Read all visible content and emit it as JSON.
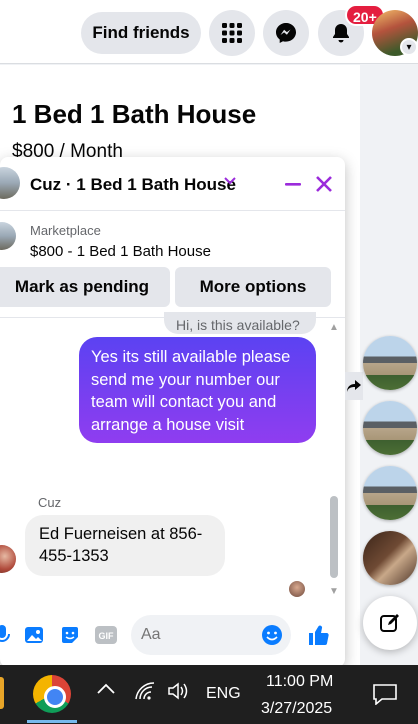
{
  "topbar": {
    "find_friends": "Find friends",
    "notification_badge": "20+",
    "icons": [
      "apps-grid-icon",
      "messenger-icon",
      "bell-icon"
    ]
  },
  "listing": {
    "title": "1 Bed 1 Bath House",
    "price": "$800 / Month"
  },
  "chat": {
    "title": "Cuz · 1 Bed 1 Bath House",
    "marketplace_label": "Marketplace",
    "marketplace_item": "$800 - 1 Bed 1 Bath House",
    "mark_pending": "Mark as pending",
    "more_options": "More options",
    "peek_message": "Hi, is this available?",
    "sent_message": "Yes its still available please send me your number our team will contact you and arrange a  house visit",
    "sender_name": "Cuz",
    "received_message": "Ed Fuerneisen at 856-455-1353",
    "input_placeholder": "Aa"
  },
  "taskbar": {
    "language": "ENG",
    "time": "11:00 PM",
    "date": "3/27/2025"
  },
  "colors": {
    "accent_purple": "#9b2bdb",
    "sent_bubble": "#6a40f1",
    "badge_red": "#e41e3f",
    "like_blue": "#0a7cff"
  }
}
